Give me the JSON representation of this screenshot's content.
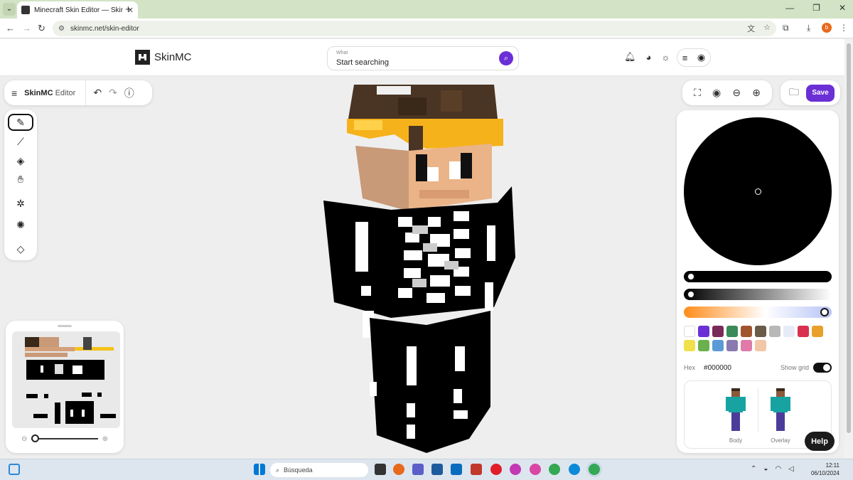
{
  "browser": {
    "tab_title": "Minecraft Skin Editor — SkinMC",
    "url": "skinmc.net/skin-editor",
    "profile_initial": "b"
  },
  "header": {
    "logo_text": "SkinMC",
    "search_label": "What",
    "search_placeholder": "Start searching"
  },
  "editor": {
    "title_bold": "SkinMC",
    "title_rest": "Editor",
    "tools": [
      "pen-icon",
      "eyedropper-icon",
      "bucket-icon",
      "hand-icon",
      "brightness-icon",
      "brightness-icon",
      "eraser-icon"
    ],
    "save_label": "Save"
  },
  "color_panel": {
    "hex_label": "Hex",
    "hex_value": "#000000",
    "show_grid_label": "Show grid",
    "show_grid": true,
    "swatches": [
      "#ffffff",
      "#6b2fd6",
      "#7a2a5a",
      "#3a8a5a",
      "#a0552e",
      "#6a5a48",
      "#b8b8b8",
      "#e6ebf7",
      "#d9304f",
      "#e8a02a",
      "#f0e04a",
      "#6ab04c",
      "#5b9bd5",
      "#8a7ab0",
      "#e07aa8",
      "#f1c7a8"
    ],
    "models": [
      "Body",
      "Overlay"
    ]
  },
  "help_label": "Help",
  "taskbar": {
    "search_text": "Búsqueda",
    "time": "12:11",
    "date": "06/10/2024"
  }
}
